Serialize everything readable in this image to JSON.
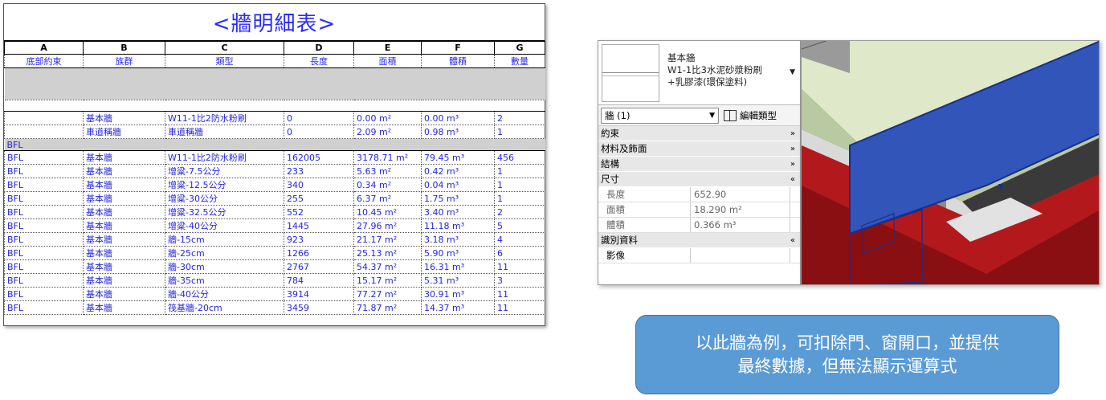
{
  "schedule": {
    "title": "<牆明細表>",
    "letters": [
      "A",
      "B",
      "C",
      "D",
      "E",
      "F",
      "G"
    ],
    "headers": [
      "底部約束",
      "族群",
      "類型",
      "長度",
      "面積",
      "體積",
      "數量"
    ],
    "top_rows": [
      [
        "",
        "基本牆",
        "W11-1比2防水粉刷",
        "0",
        "0.00 m²",
        "0.00 m³",
        "2"
      ],
      [
        "",
        "車道稱牆",
        "車道稱牆",
        "0",
        "2.09 m²",
        "0.98 m³",
        "1"
      ]
    ],
    "group_label": "BFL",
    "rows": [
      [
        "BFL",
        "基本牆",
        "W11-1比2防水粉刷",
        "162005",
        "3178.71 m²",
        "79.45 m³",
        "456"
      ],
      [
        "BFL",
        "基本牆",
        "增粱-7.5公分",
        "233",
        "5.63 m²",
        "0.42 m³",
        "1"
      ],
      [
        "BFL",
        "基本牆",
        "增粱-12.5公分",
        "340",
        "0.34 m²",
        "0.04 m³",
        "1"
      ],
      [
        "BFL",
        "基本牆",
        "增粱-30公分",
        "255",
        "6.37 m²",
        "1.75 m³",
        "1"
      ],
      [
        "BFL",
        "基本牆",
        "增粱-32.5公分",
        "552",
        "10.45 m²",
        "3.40 m³",
        "2"
      ],
      [
        "BFL",
        "基本牆",
        "增粱-40公分",
        "1445",
        "27.96 m²",
        "11.18 m³",
        "5"
      ],
      [
        "BFL",
        "基本牆",
        "牆-15cm",
        "923",
        "21.17 m²",
        "3.18 m³",
        "4"
      ],
      [
        "BFL",
        "基本牆",
        "牆-25cm",
        "1266",
        "25.13 m²",
        "5.90 m³",
        "6"
      ],
      [
        "BFL",
        "基本牆",
        "牆-30cm",
        "2767",
        "54.37 m²",
        "16.31 m³",
        "11"
      ],
      [
        "BFL",
        "基本牆",
        "牆-35cm",
        "784",
        "15.17 m²",
        "5.31 m³",
        "3"
      ],
      [
        "BFL",
        "基本牆",
        "牆-40公分",
        "3914",
        "77.27 m²",
        "30.91 m³",
        "11"
      ],
      [
        "BFL",
        "基本牆",
        "筏基牆-20cm",
        "3459",
        "71.87 m²",
        "14.37 m³",
        "11"
      ]
    ]
  },
  "properties": {
    "type_line1": "基本牆",
    "type_line2": "W1-1比3水泥砂漿粉刷",
    "type_line3": "+乳膠漆(環保塗料)",
    "selector": "牆 (1)",
    "edit_type": "編輯類型",
    "sections": {
      "constraints": "約束",
      "materials": "材料及飾面",
      "structure": "結構",
      "dimensions": "尺寸",
      "identity": "識別資料"
    },
    "dim_rows": [
      {
        "key": "長度",
        "value": "652.90"
      },
      {
        "key": "面積",
        "value": "18.290 m²"
      },
      {
        "key": "體積",
        "value": "0.366 m³"
      }
    ],
    "image_label": "影像"
  },
  "caption": {
    "line1": "以此牆為例，可扣除門、窗開口，並提供",
    "line2": "最終數據，但無法顯示運算式"
  },
  "colors": {
    "schedule_text": "#2525dd",
    "caption_bg": "#5b9bd5",
    "wall_blue": "#3155b8",
    "beam_red": "#b3191c"
  }
}
